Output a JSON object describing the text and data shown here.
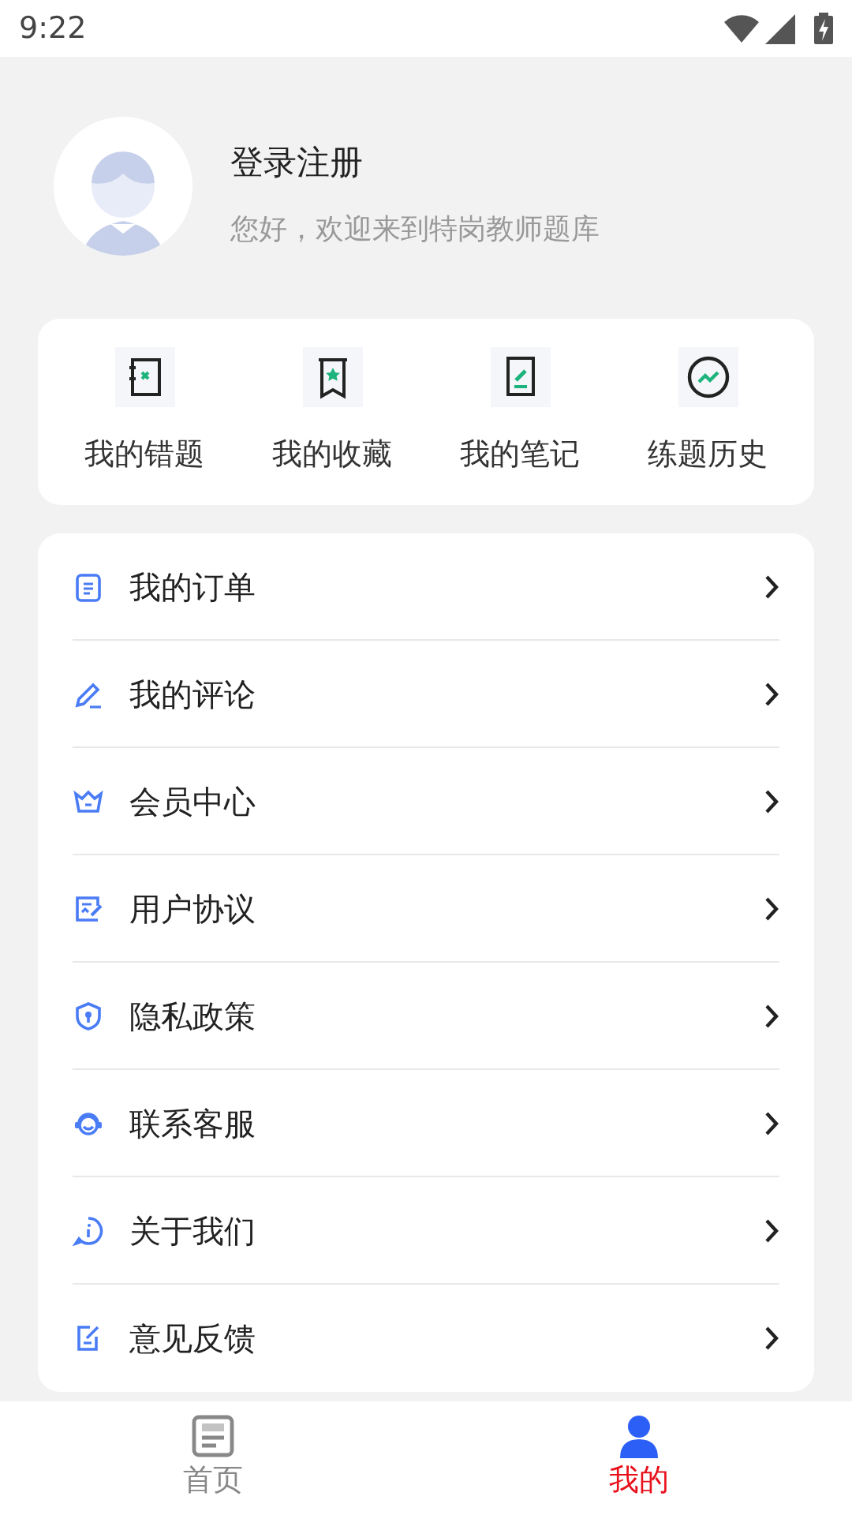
{
  "status_bar": {
    "time": "9:22"
  },
  "profile": {
    "name": "登录注册",
    "greeting": "您好，欢迎来到特岗教师题库"
  },
  "quick_actions": [
    {
      "kind": "mistakes",
      "label": "我的错题"
    },
    {
      "kind": "favorites",
      "label": "我的收藏"
    },
    {
      "kind": "notes",
      "label": "我的笔记"
    },
    {
      "kind": "history",
      "label": "练题历史"
    }
  ],
  "menu": [
    {
      "kind": "orders",
      "label": "我的订单"
    },
    {
      "kind": "comments",
      "label": "我的评论"
    },
    {
      "kind": "vip",
      "label": "会员中心"
    },
    {
      "kind": "agreement",
      "label": "用户协议"
    },
    {
      "kind": "privacy",
      "label": "隐私政策"
    },
    {
      "kind": "service",
      "label": "联系客服"
    },
    {
      "kind": "about",
      "label": "关于我们"
    },
    {
      "kind": "feedback",
      "label": "意见反馈"
    }
  ],
  "tabs": [
    {
      "kind": "home",
      "label": "首页",
      "selected": false
    },
    {
      "kind": "me",
      "label": "我的",
      "selected": true
    }
  ]
}
